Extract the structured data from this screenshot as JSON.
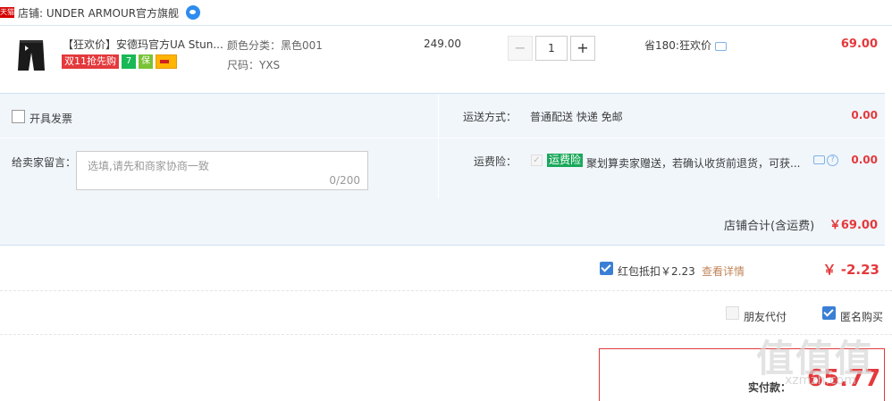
{
  "shop": {
    "tmall_badge": "天猫",
    "name": "店铺: UNDER ARMOUR官方旗舰"
  },
  "item": {
    "title": "【狂欢价】安德玛官方UA Stun...",
    "promo": {
      "d11": "双11抢先购",
      "badge1": "7",
      "badge2": "保"
    },
    "sku_color": "颜色分类：黑色001",
    "sku_size": "尺码：YXS",
    "unit_price": "249.00",
    "quantity": "1",
    "minus": "−",
    "plus": "+",
    "saving": "省180:狂欢价",
    "subtotal": "69.00"
  },
  "invoice": {
    "label": "开具发票"
  },
  "shipping": {
    "label": "运送方式：",
    "value": "普通配送 快递 免邮",
    "fee": "0.00"
  },
  "memo": {
    "label": "给卖家留言：",
    "placeholder": "选填,请先和商家协商一致",
    "count": "0/200"
  },
  "insurance": {
    "label": "运费险：",
    "check": "✓",
    "badge": "运费险",
    "desc": "聚划算卖家赠送，若确认收货前退货，可获...",
    "help": "?",
    "fee": "0.00"
  },
  "shop_total": {
    "label": "店铺合计(含运费)",
    "value": "￥69.00"
  },
  "red_packet": {
    "label": "红包抵扣￥2.23",
    "detail": "查看详情",
    "value": "￥ -2.23"
  },
  "friend_pay": {
    "label": "朋友代付"
  },
  "anonymous": {
    "label": "匿名购买"
  },
  "payment": {
    "label": "实付款：",
    "value": "65.77"
  },
  "watermark": {
    "text": "值值值",
    "sub": "xzmzh.com"
  },
  "colors": {
    "accent": "#e4393c",
    "panel": "#f1f6fb",
    "check": "#3a7fd5"
  }
}
